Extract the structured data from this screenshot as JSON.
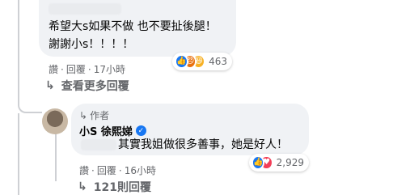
{
  "comment1": {
    "text_line1": "希望大s如果不做 也不要扯後腿！",
    "text_line2": "謝謝小s！！！！",
    "actions": {
      "like": "讚",
      "reply": "回覆",
      "time": "17小時"
    },
    "reactions": {
      "count": "463",
      "types": [
        "like",
        "angry",
        "haha"
      ]
    }
  },
  "more_replies": {
    "label": "查看更多回覆"
  },
  "reply1": {
    "author_badge": "作者",
    "author_name": "小S 徐熙娣",
    "text": "其實我姐做很多善事，她是好人！",
    "actions": {
      "like": "讚",
      "reply": "回覆",
      "time": "16小時"
    },
    "reactions": {
      "count": "2,929",
      "types": [
        "like",
        "love"
      ]
    }
  },
  "more_replies_2": {
    "label": "121則回覆"
  },
  "colors": {
    "bubble": "#f0f2f5",
    "like_blue": "#1877f2",
    "love_red": "#f33e58",
    "angry_orange": "#e9710f",
    "haha_yellow": "#f7b125",
    "muted": "#65676b"
  }
}
